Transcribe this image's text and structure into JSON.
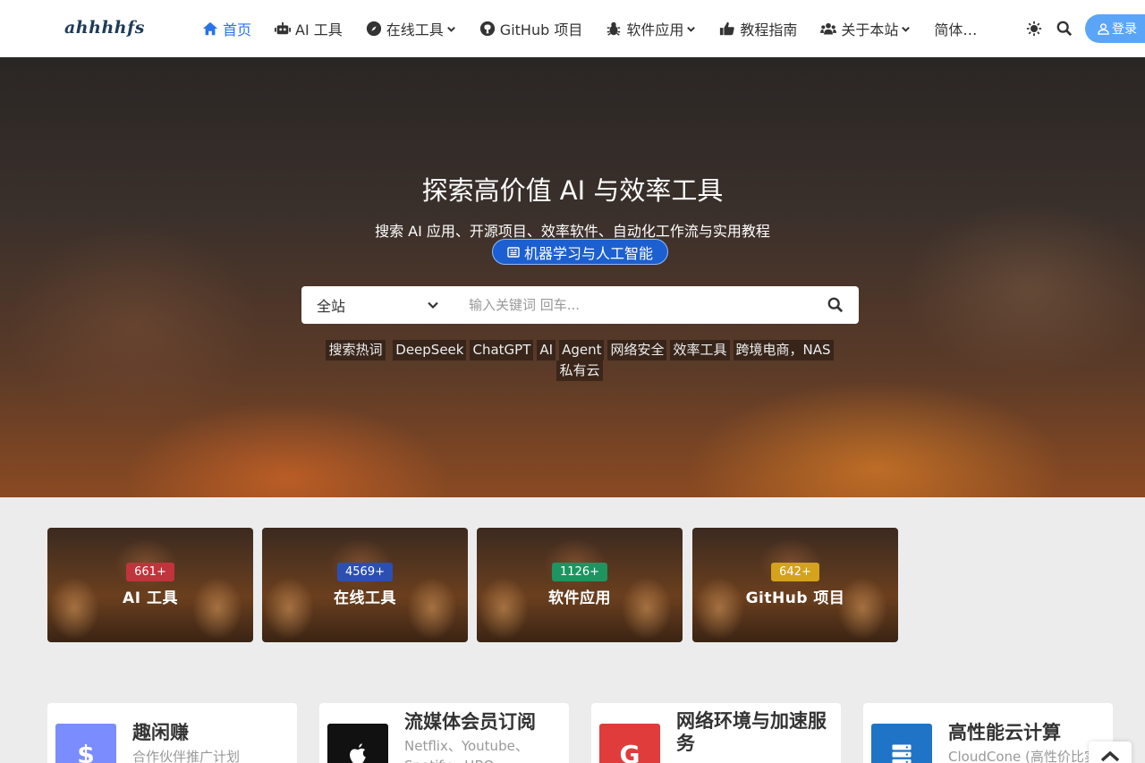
{
  "nav": {
    "logo": "ahhhhfs",
    "items": [
      {
        "label": "首页",
        "icon": "home-icon",
        "active": true,
        "dropdown": false
      },
      {
        "label": "AI 工具",
        "icon": "robot-icon",
        "active": false,
        "dropdown": false
      },
      {
        "label": "在线工具",
        "icon": "compass-icon",
        "active": false,
        "dropdown": true
      },
      {
        "label": "GitHub 项目",
        "icon": "github-icon",
        "active": false,
        "dropdown": false
      },
      {
        "label": "软件应用",
        "icon": "bug-icon",
        "active": false,
        "dropdown": true
      },
      {
        "label": "教程指南",
        "icon": "thumbs-up-icon",
        "active": false,
        "dropdown": false
      },
      {
        "label": "关于本站",
        "icon": "users-icon",
        "active": false,
        "dropdown": true
      },
      {
        "label": "简体…",
        "icon": "",
        "active": false,
        "dropdown": false
      }
    ],
    "login_label": "登录",
    "accent": "#2a73e8"
  },
  "hero": {
    "title": "探索高价值 AI 与效率工具",
    "subtitle": "搜索 AI 应用、开源项目、效率软件、自动化工作流与实用教程",
    "tag": "机器学习与人工智能",
    "search": {
      "scope": "全站",
      "placeholder": "输入关键词 回车..."
    },
    "hot_label": "搜索热词",
    "hot_words": [
      "DeepSeek",
      "ChatGPT",
      "AI",
      "Agent",
      "网络安全",
      "效率工具",
      "跨境电商，NAS",
      "私有云"
    ]
  },
  "categories": [
    {
      "count": "661+",
      "label": "AI 工具",
      "color": "#c0343b"
    },
    {
      "count": "4569+",
      "label": "在线工具",
      "color": "#2c4fb4"
    },
    {
      "count": "1126+",
      "label": "软件应用",
      "color": "#1e9460"
    },
    {
      "count": "642+",
      "label": "GitHub 项目",
      "color": "#d4a21b"
    }
  ],
  "cards": [
    {
      "title": "趣闲赚",
      "desc": "合作伙伴推广计划",
      "icon": "dollar-icon",
      "glyph": "$",
      "color": "#7b8cff"
    },
    {
      "title": "流媒体会员订阅",
      "desc": "Netflix、Youtube、Spotify、HBO…",
      "icon": "apple-icon",
      "glyph": "",
      "color": "#111111"
    },
    {
      "title": "网络环境与加速服务",
      "desc": "",
      "icon": "google-icon",
      "glyph": "G",
      "color": "#e03c3c"
    },
    {
      "title": "高性能云计算",
      "desc": "CloudCone (高性价比实惠)",
      "icon": "server-icon",
      "glyph": "",
      "color": "#1f74c8"
    }
  ]
}
